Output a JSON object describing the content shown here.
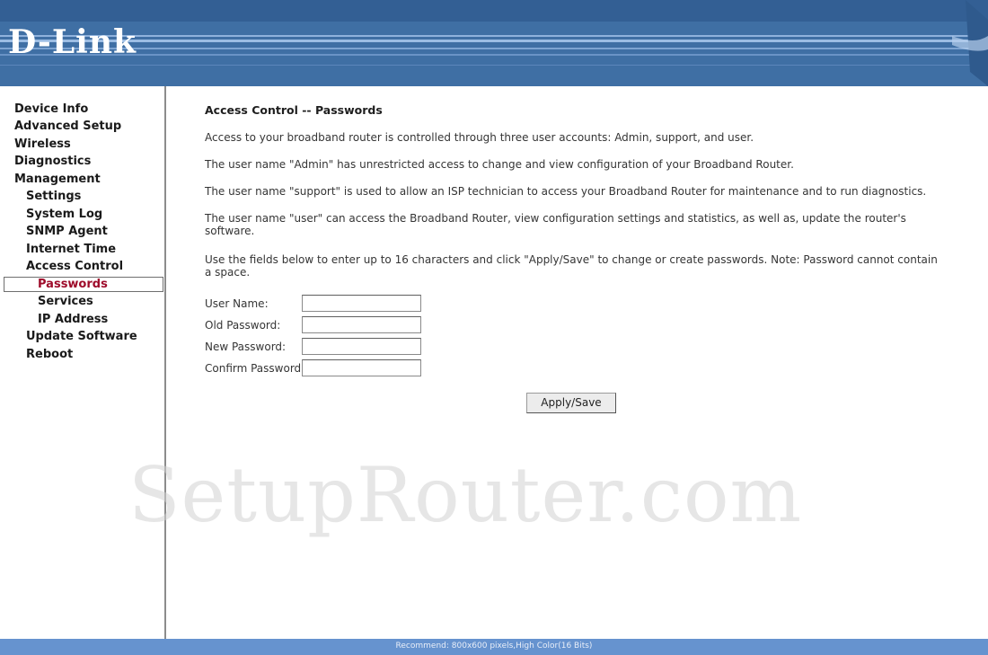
{
  "header": {
    "logo_text": "D-Link"
  },
  "sidebar": {
    "items": [
      {
        "label": "Device Info"
      },
      {
        "label": "Advanced Setup"
      },
      {
        "label": "Wireless"
      },
      {
        "label": "Diagnostics"
      },
      {
        "label": "Management"
      },
      {
        "label": "Settings"
      },
      {
        "label": "System Log"
      },
      {
        "label": "SNMP Agent"
      },
      {
        "label": "Internet Time"
      },
      {
        "label": "Access Control"
      },
      {
        "label": "Passwords",
        "active": true
      },
      {
        "label": "Services"
      },
      {
        "label": "IP Address"
      },
      {
        "label": "Update Software"
      },
      {
        "label": "Reboot"
      }
    ]
  },
  "main": {
    "title": "Access Control -- Passwords",
    "paragraphs": [
      "Access to your broadband router is controlled through three user accounts: Admin, support, and user.",
      "The user name \"Admin\" has unrestricted access to change and view configuration of your Broadband Router.",
      "The user name \"support\" is used to allow an ISP technician to access your Broadband Router for maintenance and to run diagnostics.",
      "The user name \"user\" can access the Broadband Router, view configuration settings and statistics, as well as, update the router's software.",
      "Use the fields below to enter up to 16 characters and click \"Apply/Save\" to change or create passwords. Note: Password cannot contain a space."
    ],
    "form": {
      "username_label": "User Name:",
      "old_password_label": "Old Password:",
      "new_password_label": "New Password:",
      "confirm_password_label": "Confirm Password:",
      "username_value": "",
      "old_password_value": "",
      "new_password_value": "",
      "confirm_password_value": ""
    },
    "apply_label": "Apply/Save"
  },
  "watermark": "SetupRouter.com",
  "footer": {
    "text": "Recommend: 800x600 pixels,High Color(16 Bits)"
  },
  "colors": {
    "header_blue": "#3f6fa4",
    "footer_blue": "#6693cf",
    "active_nav": "#9e0b2a"
  }
}
